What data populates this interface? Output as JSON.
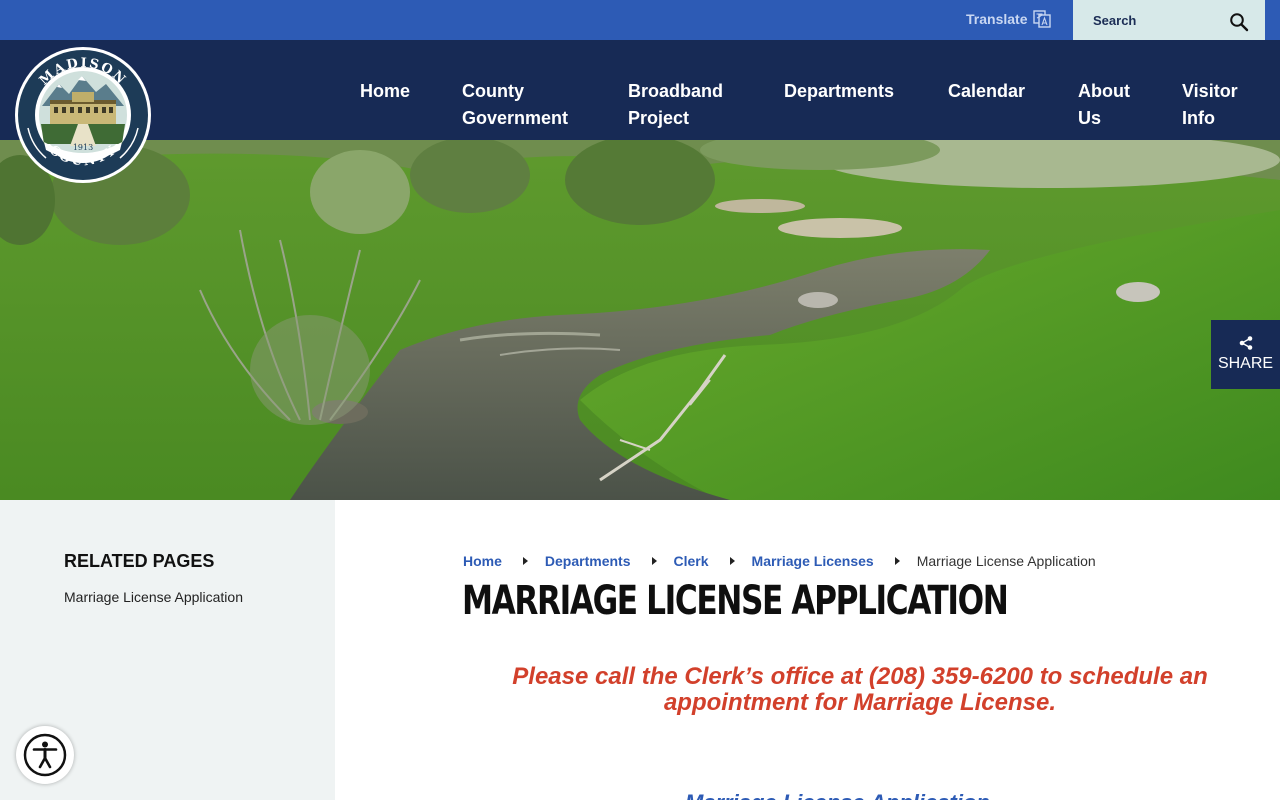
{
  "utility": {
    "translate_label": "Translate",
    "search_placeholder": "Search"
  },
  "seal": {
    "top_text": "MADISON",
    "bottom_text": "COUNTY",
    "year": "1913"
  },
  "nav": {
    "items": [
      {
        "line1": "Home",
        "line2": ""
      },
      {
        "line1": "County",
        "line2": "Government"
      },
      {
        "line1": "Broadband",
        "line2": "Project"
      },
      {
        "line1": "Departments",
        "line2": ""
      },
      {
        "line1": "Calendar",
        "line2": ""
      },
      {
        "line1": "About",
        "line2": "Us"
      },
      {
        "line1": "Visitor",
        "line2": "Info"
      }
    ]
  },
  "share": {
    "label": "SHARE",
    "icon": "share-icon"
  },
  "sidebar": {
    "title": "RELATED PAGES",
    "links": [
      "Marriage License Application"
    ]
  },
  "breadcrumb": {
    "links": [
      "Home",
      "Departments",
      "Clerk",
      "Marriage Licenses"
    ],
    "current": "Marriage License Application"
  },
  "page": {
    "title": "Marriage License Application",
    "notice": "Please call the Clerk’s office at (208) 359-6200 to schedule an appointment for Marriage License.",
    "subheading": "Marriage License Application"
  },
  "colors": {
    "utility_bar": "#2d5bb5",
    "nav_bg": "#172a55",
    "search_bg": "#d7e9e9",
    "sidebar_bg": "#eff3f3",
    "notice_red": "#d2402b",
    "link_blue": "#2d5bb5"
  },
  "accessibility": {
    "icon": "accessibility-icon"
  }
}
